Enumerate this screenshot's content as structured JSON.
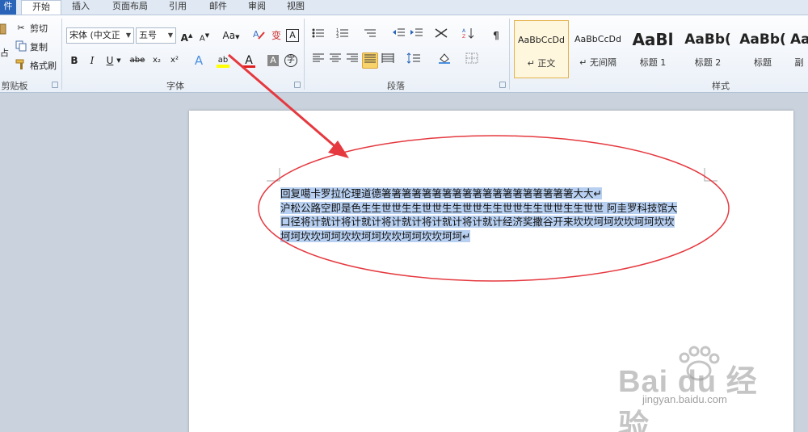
{
  "tabs": [
    {
      "label": "件",
      "kind": "file"
    },
    {
      "label": "开始",
      "kind": "active"
    },
    {
      "label": "插入"
    },
    {
      "label": "页面布局"
    },
    {
      "label": "引用"
    },
    {
      "label": "邮件"
    },
    {
      "label": "审阅"
    },
    {
      "label": "视图"
    }
  ],
  "clipboard": {
    "paste_label": "占",
    "cut_label": "剪切",
    "copy_label": "复制",
    "format_painter_label": "格式刷",
    "group_label": "剪贴板"
  },
  "font": {
    "font_name": "宋体 (中文正",
    "font_size": "五号",
    "grow_label": "A",
    "shrink_label": "A",
    "case_label": "Aa",
    "clear_label": "✘",
    "phonetic_label": "变",
    "border_char_label": "A",
    "bold": "B",
    "italic": "I",
    "underline": "U",
    "strike": "abe",
    "subscript": "x₂",
    "superscript": "x²",
    "effects": "A",
    "highlight": "ab",
    "color": "A",
    "shading": "A",
    "enclose": "字",
    "group_label": "字体",
    "highlight_color": "#ffff00",
    "font_color": "#e02020"
  },
  "paragraph": {
    "group_label": "段落"
  },
  "styles": {
    "group_label": "样式",
    "items": [
      {
        "sample": "AaBbCcDd",
        "name": "↵ 正文",
        "selected": true
      },
      {
        "sample": "AaBbCcDd",
        "name": "↵ 无间隔"
      },
      {
        "sample": "AaBl",
        "name": "标题 1"
      },
      {
        "sample": "AaBb(",
        "name": "标题 2"
      },
      {
        "sample": "AaBb(",
        "name": "标题"
      },
      {
        "sample": "Aa",
        "name": "副"
      }
    ]
  },
  "document": {
    "lines": [
      "回复噶卡罗拉伦理道德箸箸箸箸箸箸箸箸箸箸箸箸箸箸箸箸箸箸箸大大↵",
      "沪松公路空即是色生生世世生生世世生生世世生生世世生生世世生生世世 阿圭罗科技馆大",
      "口径将计就计将计就计将计就计将计就计将计就计经济奖撒谷开来坎坎坷坷坎坎坷坷坎坎",
      "坷坷坎坎坷坷坎坎坷坷坎坎坷坷坎坎坷坷↵"
    ],
    "selection_color": "#b7cff0"
  },
  "annotations": {
    "arrow_color": "#e5393f",
    "ellipse_color": "#e5393f"
  },
  "watermark": {
    "brand": "Bai du 经验",
    "url": "jingyan.baidu.com"
  }
}
